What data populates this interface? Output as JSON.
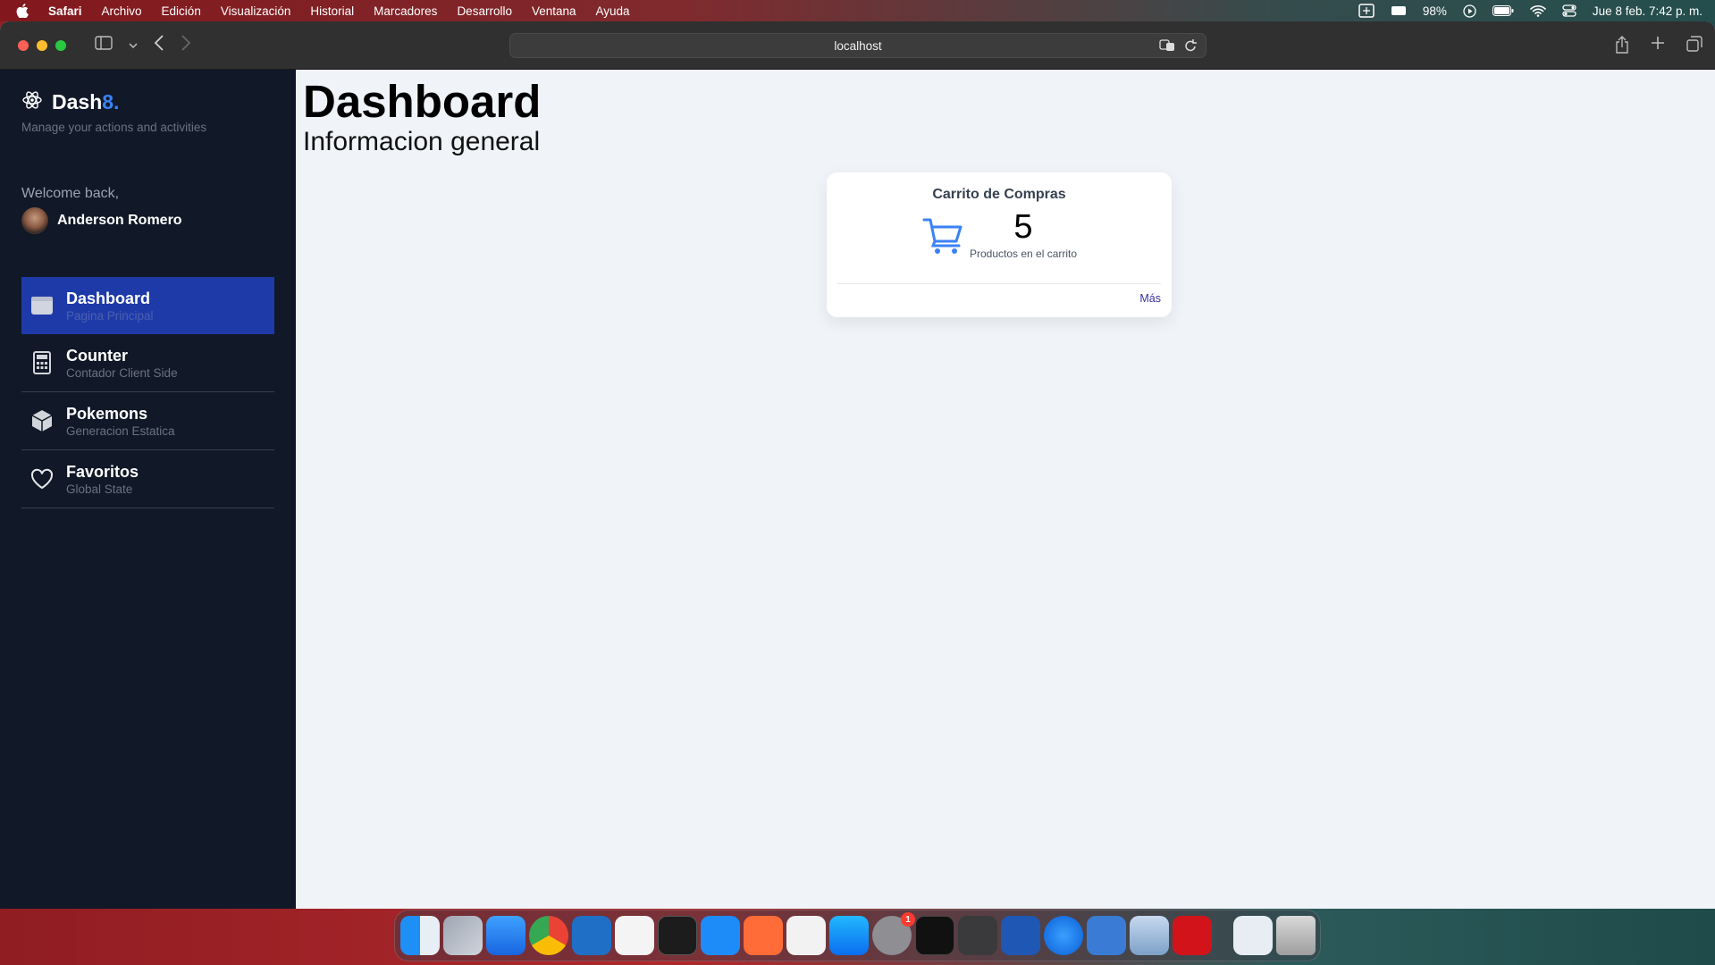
{
  "menubar": {
    "app_name": "Safari",
    "items": [
      "Archivo",
      "Edición",
      "Visualización",
      "Historial",
      "Marcadores",
      "Desarrollo",
      "Ventana",
      "Ayuda"
    ],
    "battery": "98%",
    "datetime": "Jue 8 feb.  7:42 p. m."
  },
  "browser": {
    "url": "localhost"
  },
  "sidebar": {
    "brand_name": "Dash",
    "brand_accent": "8.",
    "tagline": "Manage your actions and activities",
    "welcome": "Welcome back,",
    "user_name": "Anderson Romero",
    "items": [
      {
        "label": "Dashboard",
        "sub": "Pagina Principal",
        "icon": "window-icon",
        "active": true
      },
      {
        "label": "Counter",
        "sub": "Contador Client Side",
        "icon": "calculator-icon"
      },
      {
        "label": "Pokemons",
        "sub": "Generacion Estatica",
        "icon": "box-icon"
      },
      {
        "label": "Favoritos",
        "sub": "Global State",
        "icon": "heart-icon"
      }
    ]
  },
  "main": {
    "title": "Dashboard",
    "subtitle": "Informacion general",
    "card": {
      "title": "Carrito de Compras",
      "count": "5",
      "description": "Productos en el carrito",
      "link": "Más"
    }
  },
  "dock": {
    "settings_badge": "1"
  },
  "colors": {
    "sidebar_bg": "#111827",
    "active_item": "#1e3aa8",
    "accent": "#3b82f6",
    "link": "#3730a3"
  }
}
